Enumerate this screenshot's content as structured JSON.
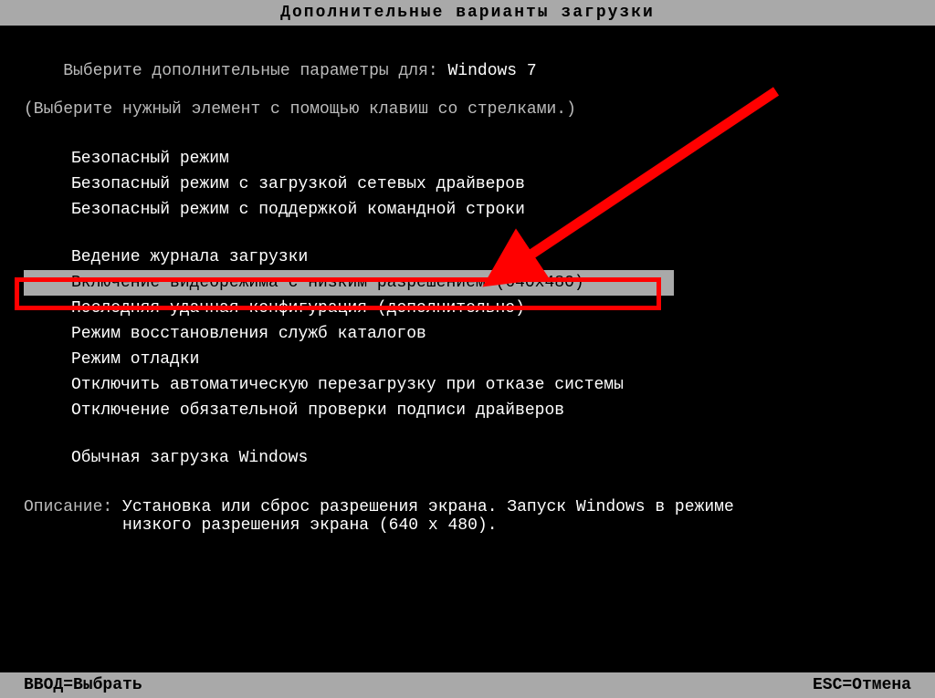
{
  "title": "Дополнительные варианты загрузки",
  "prompt_prefix": "Выберите дополнительные параметры для: ",
  "os_name": "Windows 7",
  "instruction": "(Выберите нужный элемент с помощью клавиш со стрелками.)",
  "options": {
    "group1": [
      "Безопасный режим",
      "Безопасный режим с загрузкой сетевых драйверов",
      "Безопасный режим с поддержкой командной строки"
    ],
    "group2": [
      "Ведение журнала загрузки",
      "Включение видеорежима с низким разрешением (640x480)",
      "Последняя удачная конфигурация (дополнительно)",
      "Режим восстановления служб каталогов",
      "Режим отладки",
      "Отключить автоматическую перезагрузку при отказе системы",
      "Отключение обязательной проверки подписи драйверов"
    ],
    "group3": [
      "Обычная загрузка Windows"
    ]
  },
  "selected_option": "Включение видеорежима с низким разрешением (640x480)",
  "description": {
    "label": "Описание: ",
    "line1": "Установка или сброс разрешения экрана. Запуск Windows в режиме",
    "line2_indent": "          ",
    "line2": "низкого разрешения экрана (640 x 480)."
  },
  "footer": {
    "enter": "ВВОД=Выбрать",
    "esc": "ESC=Отмена"
  },
  "annotation": {
    "arrow_color": "#ff0000",
    "box_color": "#ff0000"
  }
}
